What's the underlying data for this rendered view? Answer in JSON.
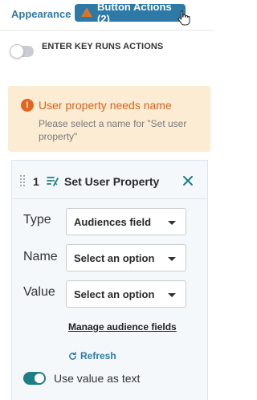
{
  "tabs": {
    "appearance_label": "Appearance",
    "actions_label": "Button Actions (2)"
  },
  "enter_key": {
    "label": "ENTER KEY RUNS ACTIONS",
    "enabled": false
  },
  "alert": {
    "icon": "!",
    "title": "User property needs name",
    "message": "Please select a name for \"Set user property\""
  },
  "action": {
    "number": "1",
    "title": "Set User Property",
    "fields": {
      "type_label": "Type",
      "type_value": "Audiences field",
      "name_label": "Name",
      "name_value": "Select an option",
      "value_label": "Value",
      "value_value": "Select an option"
    },
    "manage_link": "Manage audience fields",
    "refresh_label": "Refresh",
    "use_value_label": "Use value as text",
    "use_value_enabled": true
  },
  "colors": {
    "accent": "#2e7aa6",
    "warning_bg": "#fcecd3",
    "warning_text": "#d9621b",
    "toggle_on": "#1f7d86"
  }
}
